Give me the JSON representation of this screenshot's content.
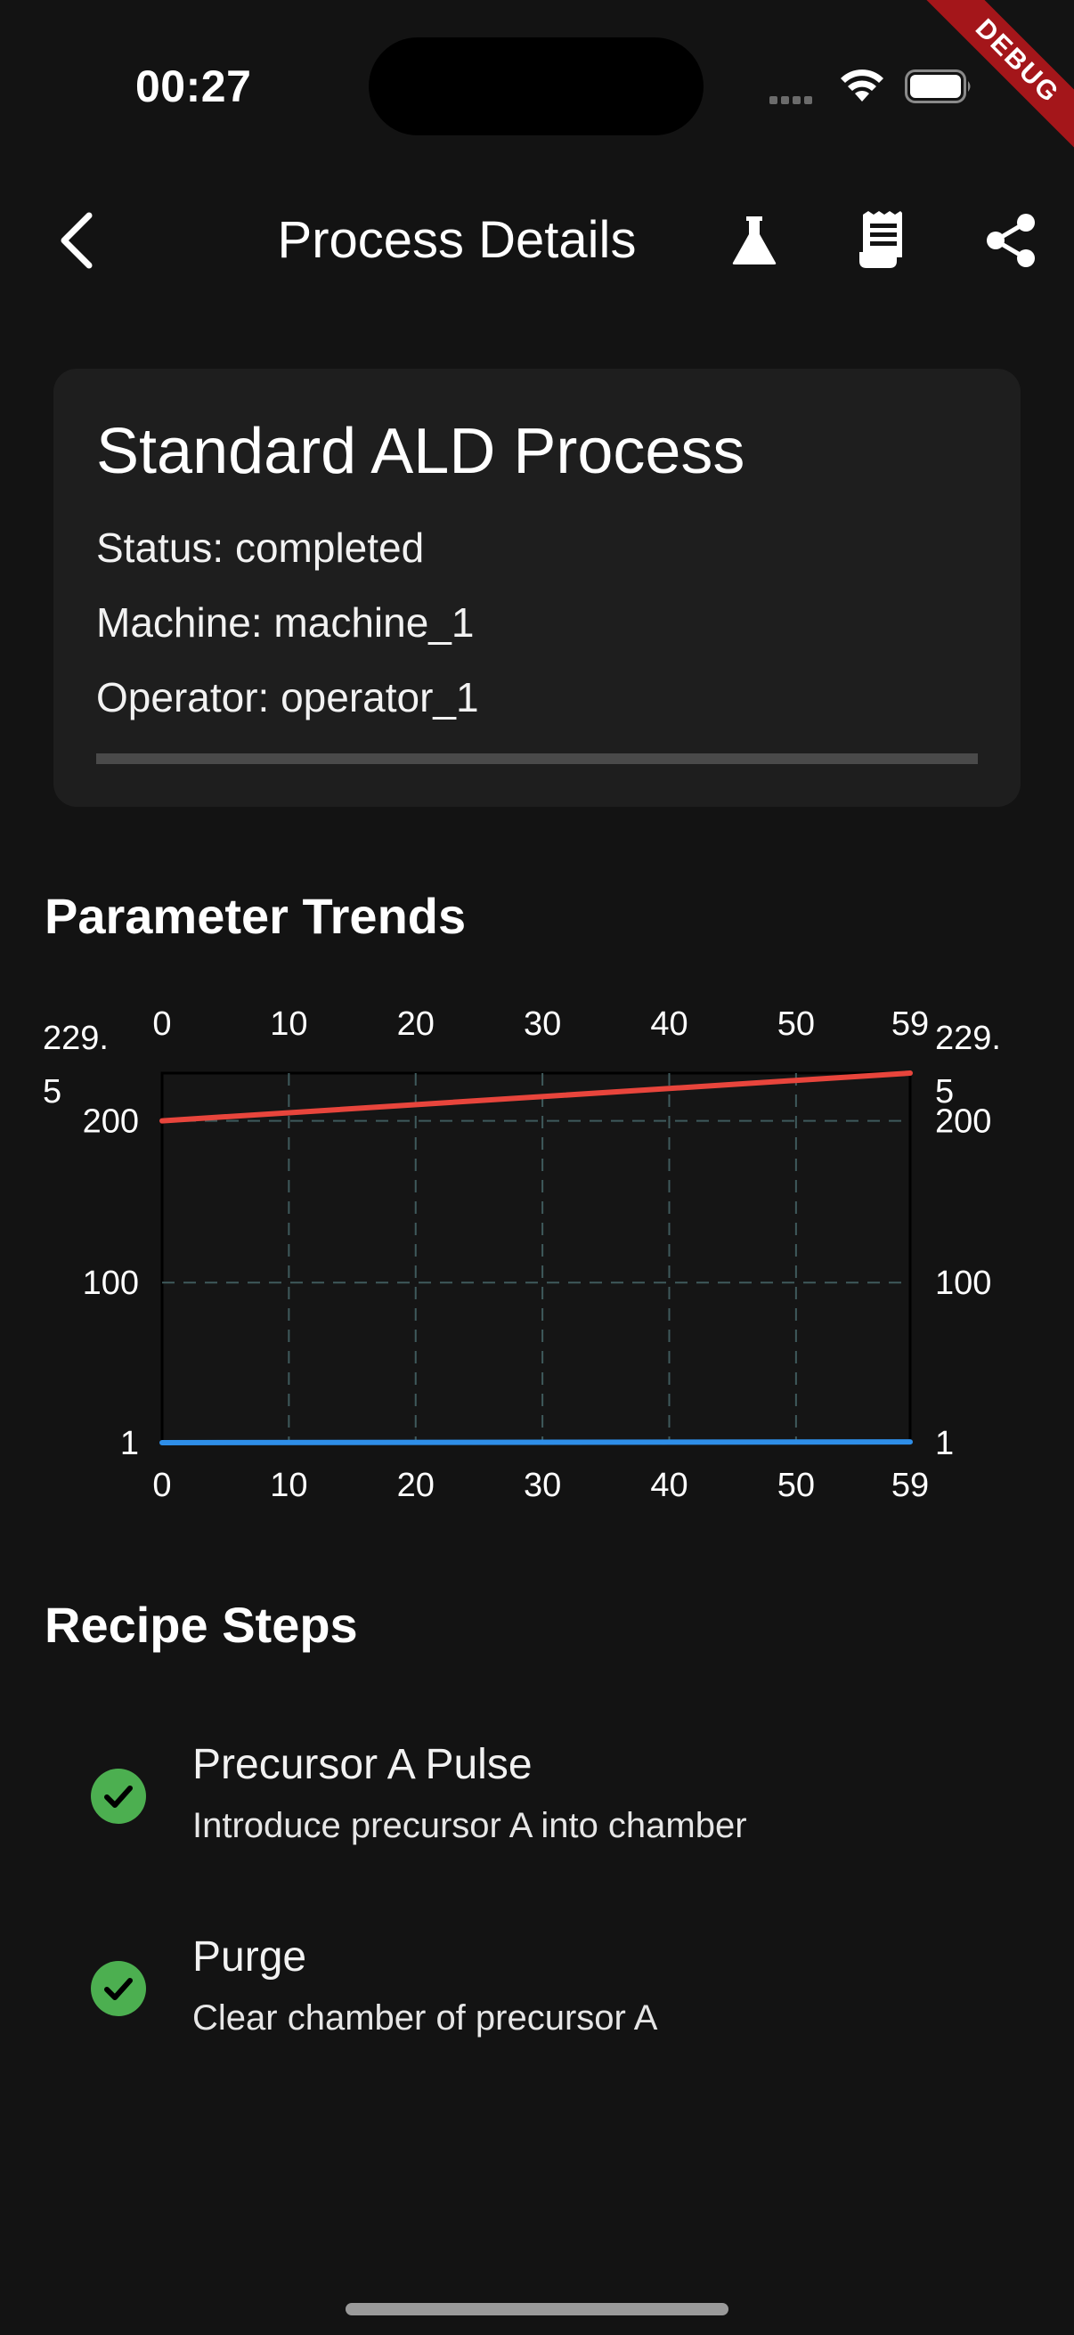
{
  "status_bar": {
    "time": "00:27"
  },
  "debug_banner": {
    "label": "DEBUG"
  },
  "app_bar": {
    "title": "Process Details",
    "icons": [
      "back-arrow-icon",
      "flask-icon",
      "receipt-icon",
      "share-icon"
    ]
  },
  "process": {
    "name": "Standard ALD Process",
    "status": "Status: completed",
    "machine": "Machine: machine_1",
    "operator": "Operator: operator_1",
    "progress": 1.0
  },
  "parameter_trends": {
    "heading": "Parameter Trends"
  },
  "chart_data": {
    "type": "line",
    "x_ticks": [
      "0",
      "10",
      "20",
      "30",
      "40",
      "50",
      "59"
    ],
    "left_y_ticks": [
      "229.\n5",
      "200",
      "100",
      "1"
    ],
    "right_y_ticks": [
      "229.\n5",
      "200",
      "100",
      "1"
    ],
    "xlim": [
      0,
      59
    ],
    "ylim": [
      1,
      229.5
    ],
    "grid": true,
    "series": [
      {
        "color": "#e8453c",
        "x": [
          0,
          59
        ],
        "values": [
          200,
          229.5
        ]
      },
      {
        "color": "#2e8ee8",
        "x": [
          0,
          59
        ],
        "values": [
          1,
          1.5
        ]
      }
    ]
  },
  "recipe_steps": {
    "heading": "Recipe Steps",
    "items": [
      {
        "name": "Precursor A Pulse",
        "description": "Introduce precursor A into chamber",
        "icon": "check-circle-icon",
        "color": "#4caf50"
      },
      {
        "name": "Purge",
        "description": "Clear chamber of precursor A",
        "icon": "check-circle-icon",
        "color": "#4caf50"
      }
    ]
  }
}
